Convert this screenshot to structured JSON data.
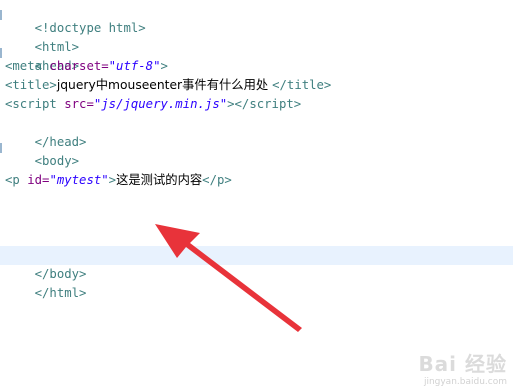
{
  "code": {
    "line1": {
      "text": "<!doctype html>"
    },
    "line2": {
      "text": "<html>"
    },
    "line3": {
      "text": "<head>"
    },
    "line4": {
      "tag_open": "<meta ",
      "attr": "charset=",
      "val": "\"utf-8\"",
      "tag_close": ">"
    },
    "line5": {
      "tag_open": "<title>",
      "text": "jquery中mouseenter事件有什么用处 ",
      "tag_close": "</title>"
    },
    "line6": {
      "tag_open": "<script ",
      "attr": "src=",
      "val": "\"js/jquery.min.js\"",
      "tag_mid": "></",
      "tag_close": "script>"
    },
    "line7": {
      "text": "</head>"
    },
    "line8": {
      "text": "<body>"
    },
    "line10": {
      "tag_open": "<p ",
      "attr": "id=",
      "val": "\"mytest\"",
      "tag_mid": ">",
      "text": "这是测试的内容",
      "tag_close": "</p>"
    },
    "line14": {
      "text": "</body>"
    },
    "line15": {
      "text": "</html>"
    }
  },
  "colors": {
    "tag": "#3f7f7f",
    "attribute": "#7f007f",
    "value": "#2a00ff",
    "current_line": "#e8f2fe",
    "arrow": "#e8333a"
  },
  "watermark": {
    "brand": "Bai 经验",
    "url": "jingyan.baidu.com"
  }
}
